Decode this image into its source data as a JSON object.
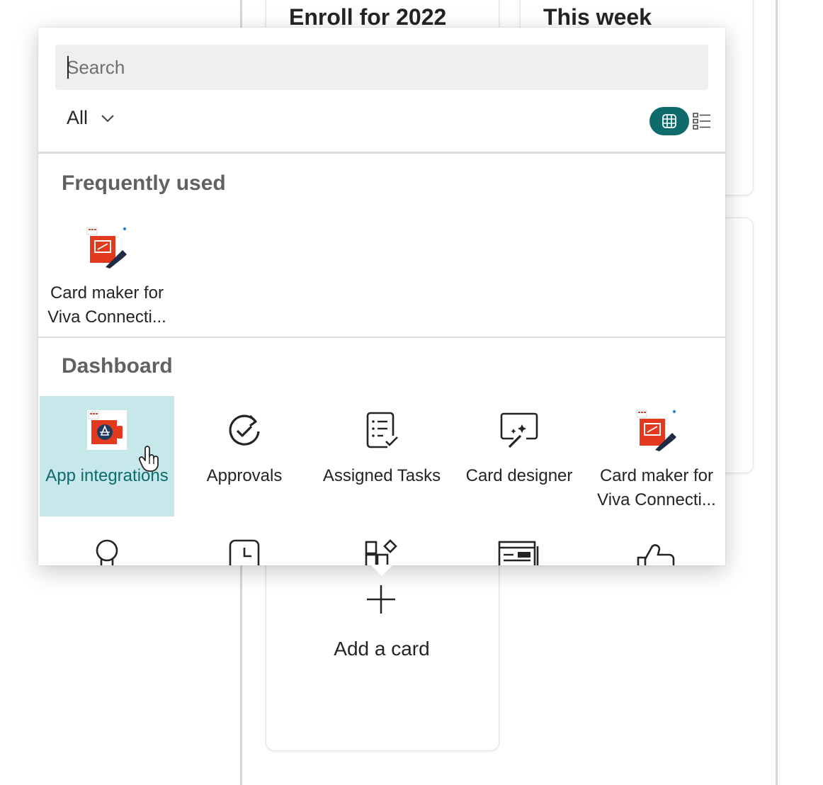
{
  "background": {
    "cards": [
      {
        "title": "Enroll for 2022"
      },
      {
        "title": "This week"
      }
    ],
    "add_card": {
      "label": "Add a card"
    }
  },
  "toolbox": {
    "search": {
      "placeholder": "Search",
      "value": ""
    },
    "filter": {
      "label": "All"
    },
    "view_toggle": {
      "grid": "grid-icon",
      "list": "list-icon",
      "selected": "grid"
    },
    "sections": [
      {
        "title": "Frequently used",
        "items": [
          {
            "label": "Card maker for Viva Connecti...",
            "icon": "card-maker-icon"
          }
        ]
      },
      {
        "title": "Dashboard",
        "items": [
          {
            "label": "App integrations",
            "icon": "app-integrations-icon",
            "selected": true
          },
          {
            "label": "Approvals",
            "icon": "approvals-icon"
          },
          {
            "label": "Assigned Tasks",
            "icon": "assigned-tasks-icon"
          },
          {
            "label": "Card designer",
            "icon": "card-designer-icon"
          },
          {
            "label": "Card maker for Viva Connecti...",
            "icon": "card-maker-icon"
          }
        ],
        "next_row_icons": [
          "ribbon-icon",
          "clock-icon",
          "apps-add-icon",
          "news-icon",
          "thumbs-up-icon"
        ]
      }
    ]
  },
  "colors": {
    "accent": "#0e6b6b",
    "selected_bg": "#c7e8ea",
    "brand_orange": "#e2391f"
  }
}
